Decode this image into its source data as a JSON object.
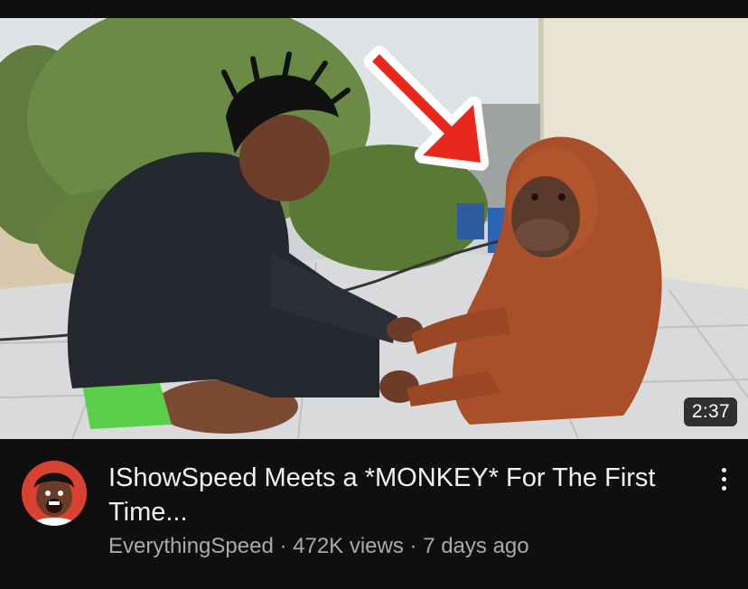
{
  "video": {
    "duration": "2:37",
    "title": "IShowSpeed Meets a *MONKEY* For The First Time...",
    "channel": "EverythingSpeed",
    "separator": " · ",
    "views": "472K views",
    "age": "7 days ago"
  },
  "icons": {
    "menu": "more-vertical-icon",
    "arrow": "red-arrow-icon"
  },
  "colors": {
    "background": "#0f0f0f",
    "title_text": "#f1f1f1",
    "meta_text": "#aaaaaa",
    "arrow_red": "#e8281c"
  }
}
